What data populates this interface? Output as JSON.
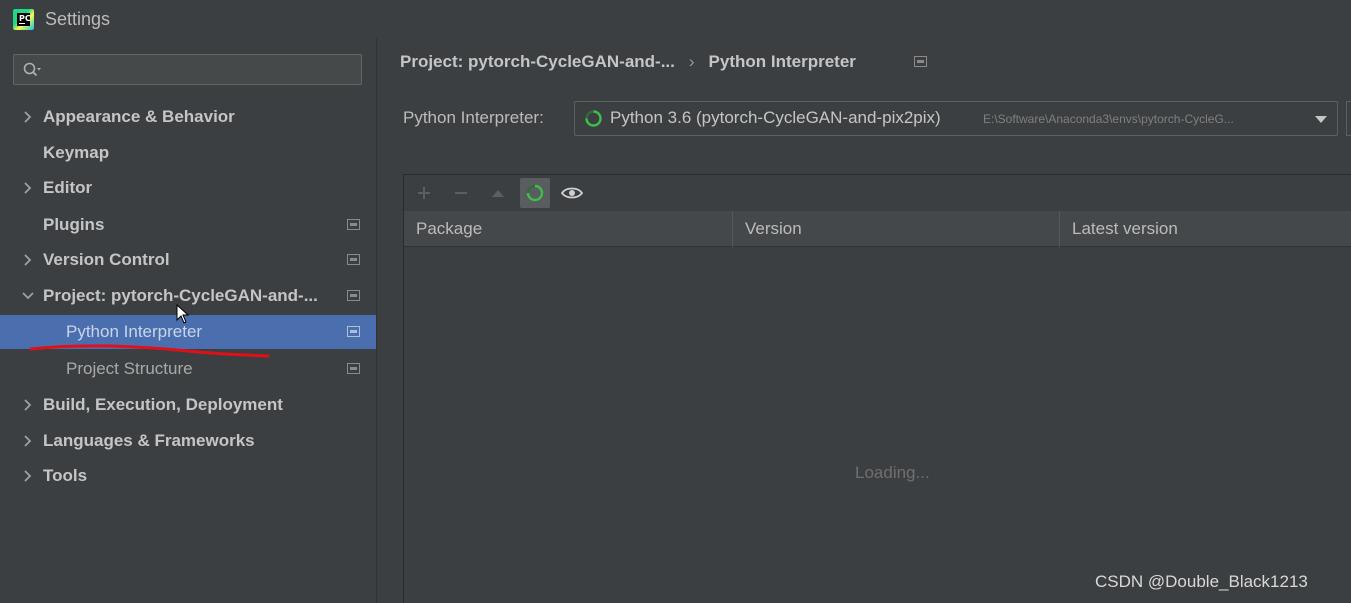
{
  "window": {
    "title": "Settings",
    "app_icon": "pycharm-icon"
  },
  "search": {
    "placeholder": "",
    "icon": "search-icon"
  },
  "tree": {
    "items": [
      {
        "label": "Appearance & Behavior",
        "expandable": true
      },
      {
        "label": "Keymap",
        "expandable": false
      },
      {
        "label": "Editor",
        "expandable": true
      },
      {
        "label": "Plugins",
        "expandable": false,
        "project_icon": true
      },
      {
        "label": "Version Control",
        "expandable": true,
        "project_icon": true
      },
      {
        "label": "Project: pytorch-CycleGAN-and-...",
        "expandable": true,
        "expanded": true,
        "project_icon": true
      },
      {
        "label": "Python Interpreter",
        "child": true,
        "selected": true,
        "project_icon": true
      },
      {
        "label": "Project Structure",
        "child": true,
        "project_icon": true
      },
      {
        "label": "Build, Execution, Deployment",
        "expandable": true
      },
      {
        "label": "Languages & Frameworks",
        "expandable": true
      },
      {
        "label": "Tools",
        "expandable": true
      }
    ],
    "selected_color": "#4b6eaf"
  },
  "breadcrumb": {
    "parent": "Project: pytorch-CycleGAN-and-...",
    "separator": "›",
    "current": "Python Interpreter"
  },
  "interpreter": {
    "label": "Python Interpreter:",
    "value": "Python 3.6 (pytorch-CycleGAN-and-pix2pix)",
    "path": "E:\\Software\\Anaconda3\\envs\\pytorch-CycleG..."
  },
  "packages": {
    "columns": [
      "Package",
      "Version",
      "Latest version"
    ],
    "status": "Loading...",
    "toolbar": [
      "add-icon",
      "remove-icon",
      "upgrade-icon",
      "refresh-icon",
      "eye-icon"
    ]
  },
  "watermark": "CSDN @Double_Black1213",
  "colors": {
    "background": "#3c3f41",
    "selection": "#4b6eaf",
    "annotation": "#e0101a",
    "spinner": "#3fbf4a"
  }
}
